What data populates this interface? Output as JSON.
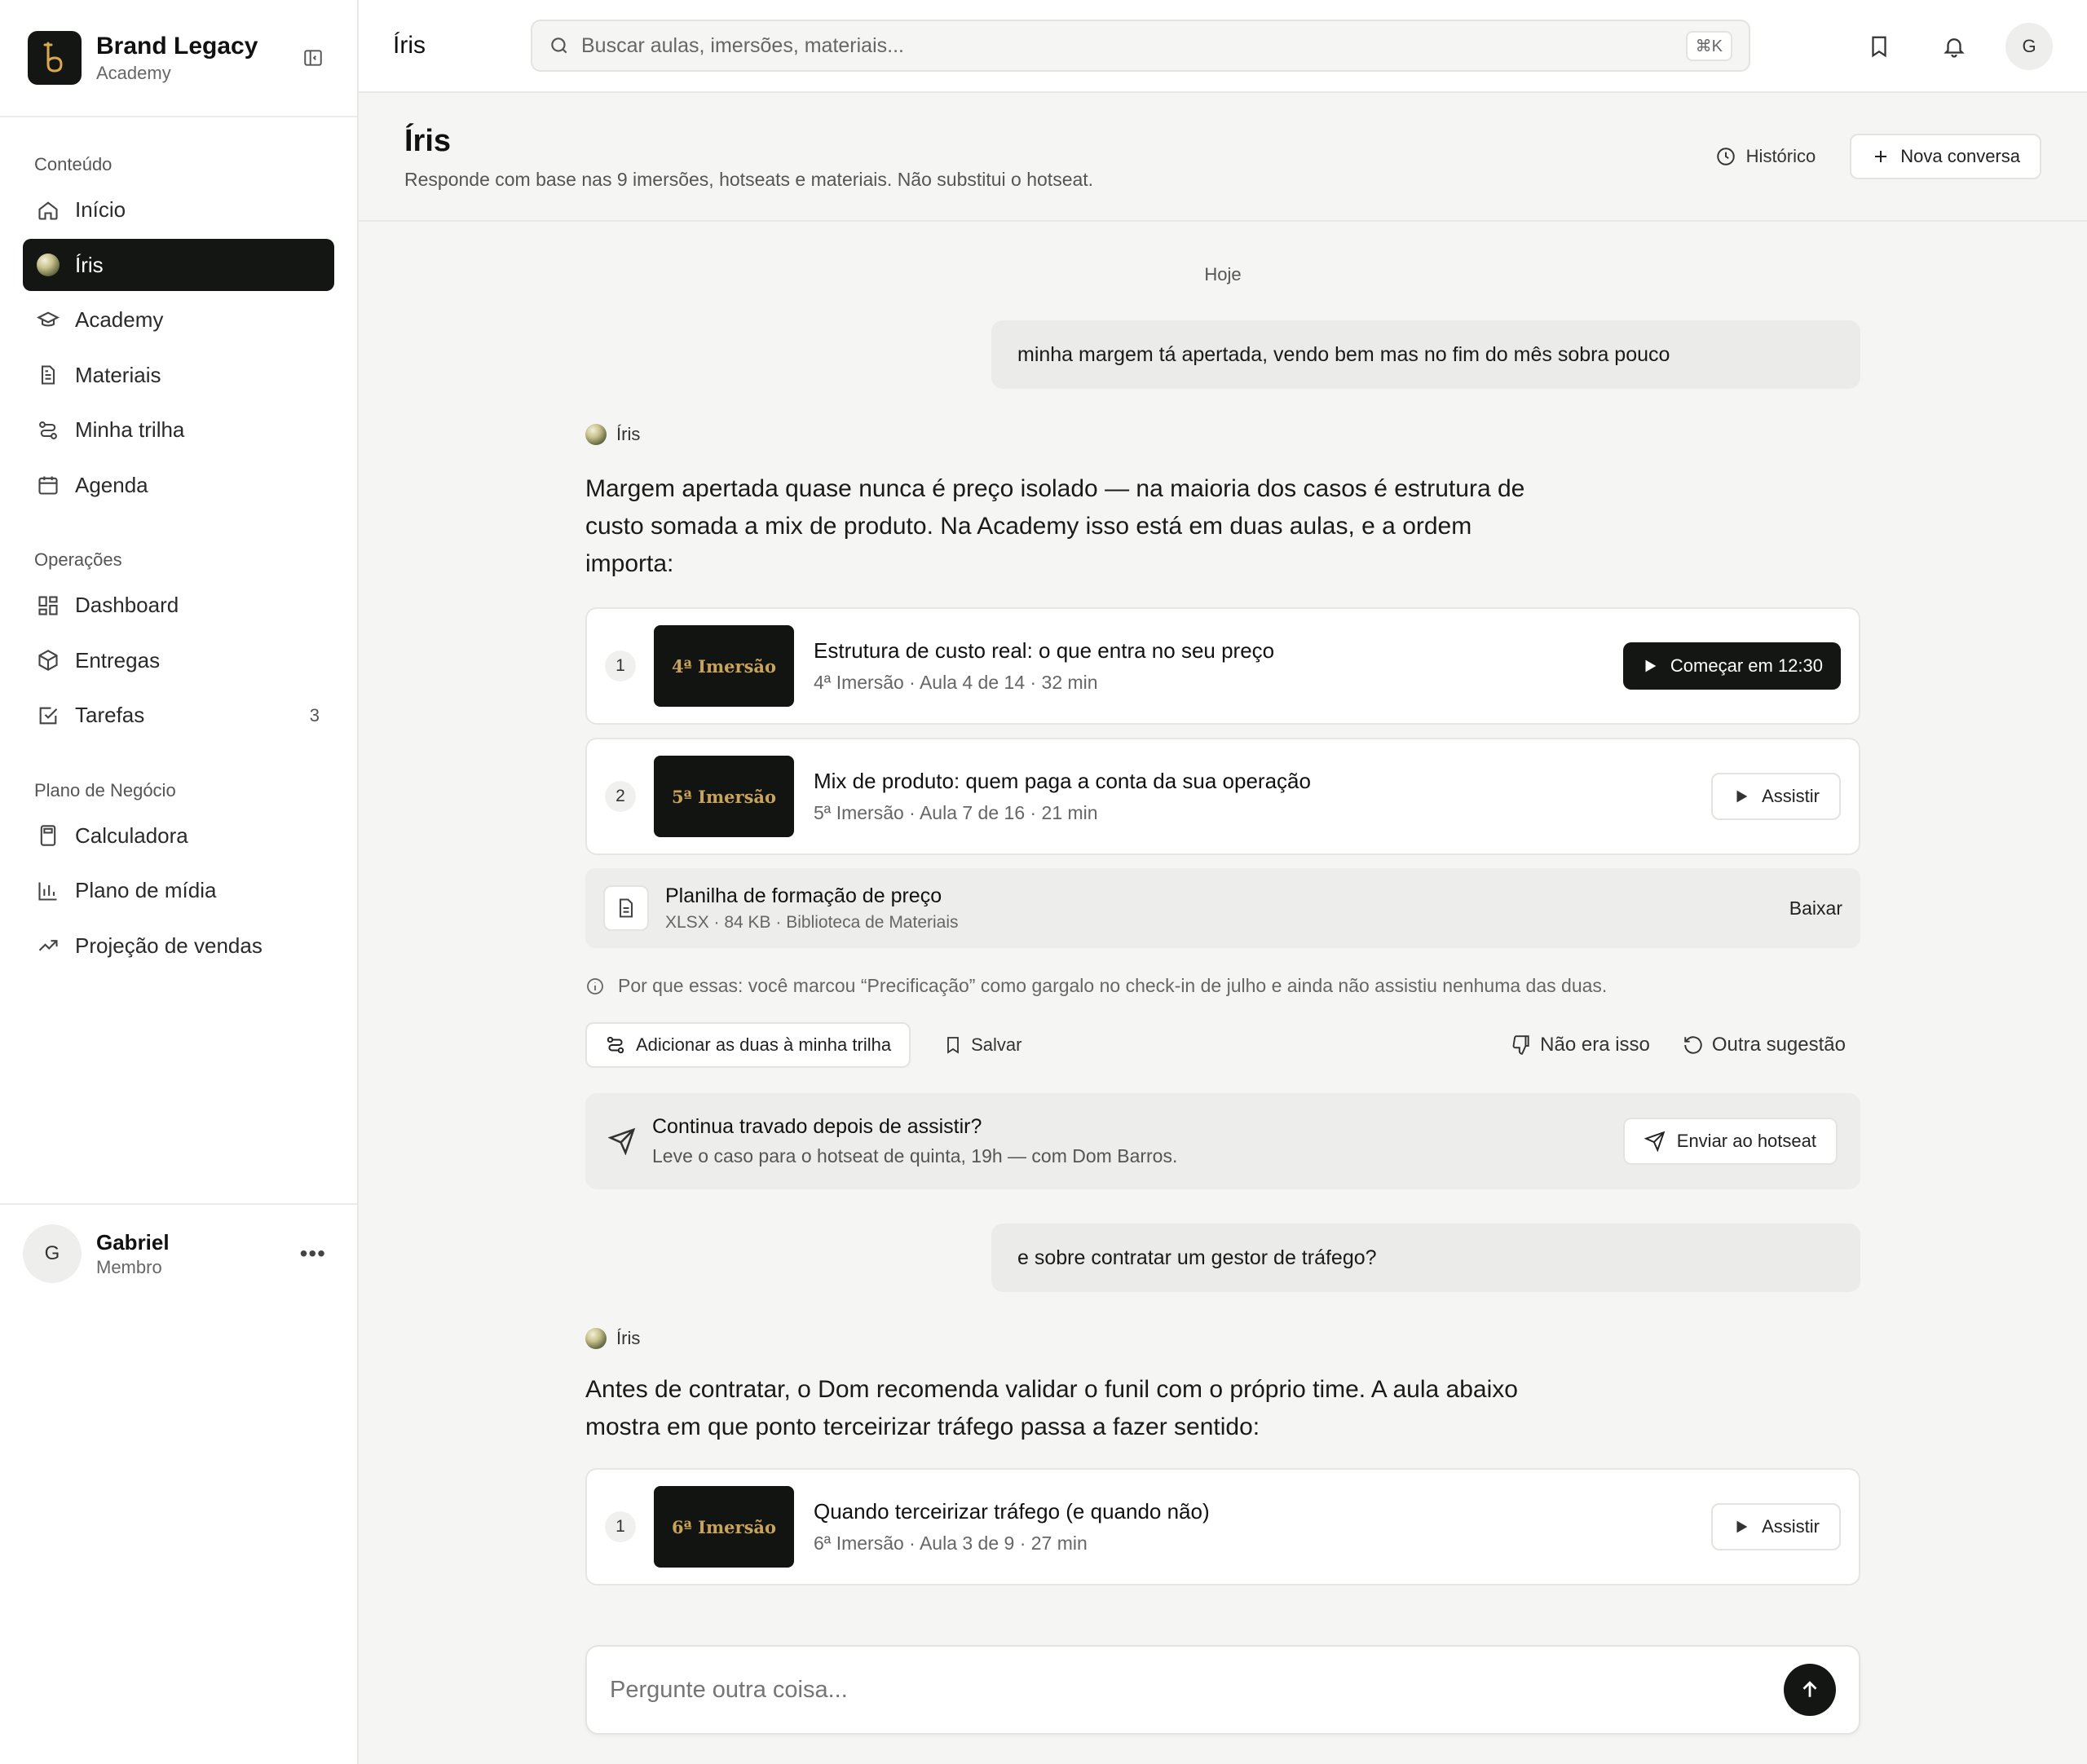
{
  "brand": {
    "title": "Brand Legacy",
    "subtitle": "Academy"
  },
  "sidebar": {
    "sections": [
      {
        "title": "Conteúdo",
        "items": [
          {
            "label": "Início",
            "icon": "home-icon"
          },
          {
            "label": "Íris",
            "icon": "iris-orb-icon",
            "active": true
          },
          {
            "label": "Academy",
            "icon": "graduation-cap-icon"
          },
          {
            "label": "Materiais",
            "icon": "document-icon"
          },
          {
            "label": "Minha trilha",
            "icon": "route-icon"
          },
          {
            "label": "Agenda",
            "icon": "calendar-icon"
          }
        ]
      },
      {
        "title": "Operações",
        "items": [
          {
            "label": "Dashboard",
            "icon": "dashboard-icon"
          },
          {
            "label": "Entregas",
            "icon": "package-icon"
          },
          {
            "label": "Tarefas",
            "icon": "checkbox-icon",
            "count": "3"
          }
        ]
      },
      {
        "title": "Plano de Negócio",
        "items": [
          {
            "label": "Calculadora",
            "icon": "calculator-icon"
          },
          {
            "label": "Plano de mídia",
            "icon": "bar-chart-icon"
          },
          {
            "label": "Projeção de vendas",
            "icon": "trending-up-icon"
          }
        ]
      }
    ],
    "user": {
      "initial": "G",
      "name": "Gabriel",
      "role": "Membro",
      "more": "•••"
    }
  },
  "topbar": {
    "title": "Íris",
    "search_placeholder": "Buscar aulas, imersões, materiais...",
    "shortcut": "⌘K",
    "avatar_initial": "G"
  },
  "page": {
    "title": "Íris",
    "subtitle": "Responde com base nas 9 imersões, hotseats e materiais. Não substitui o hotseat.",
    "history_label": "Histórico",
    "new_chat_label": "Nova conversa"
  },
  "chat": {
    "day_label": "Hoje",
    "user_msg_1": "minha margem tá apertada, vendo bem mas no fim do mês sobra pouco",
    "assistant_name": "Íris",
    "assistant_msg_1": "Margem apertada quase nunca é preço isolado — na maioria dos casos é estrutura de custo somada a mix de produto. Na Academy isso está em duas aulas, e a ordem importa:",
    "lessons_1": [
      {
        "num": "1",
        "thumb": "4ª Imersão",
        "title": "Estrutura de custo real: o que entra no seu preço",
        "meta": "4ª Imersão · Aula 4 de 14 · 32 min",
        "cta": "Começar em 12:30"
      },
      {
        "num": "2",
        "thumb": "5ª Imersão",
        "title": "Mix de produto: quem paga a conta da sua operação",
        "meta": "5ª Imersão · Aula 7 de 16 · 21 min",
        "cta": "Assistir"
      }
    ],
    "file": {
      "title": "Planilha de formação de preço",
      "meta": "XLSX · 84 KB · Biblioteca de Materiais",
      "action": "Baixar"
    },
    "why": "Por que essas: você marcou “Precificação” como gargalo no check-in de julho e ainda não assistiu nenhuma das duas.",
    "actions": {
      "add_trail": "Adicionar as duas à minha trilha",
      "save": "Salvar",
      "not_it": "Não era isso",
      "other": "Outra sugestão"
    },
    "hotseat": {
      "title": "Continua travado depois de assistir?",
      "subtitle": "Leve o caso para o hotseat de quinta, 19h — com Dom Barros.",
      "cta": "Enviar ao hotseat"
    },
    "user_msg_2": "e sobre contratar um gestor de tráfego?",
    "assistant_msg_2": "Antes de contratar, o Dom recomenda validar o funil com o próprio time. A aula abaixo mostra em que ponto terceirizar tráfego passa a fazer sentido:",
    "lessons_2": [
      {
        "num": "1",
        "thumb": "6ª Imersão",
        "title": "Quando terceirizar tráfego (e quando não)",
        "meta": "6ª Imersão · Aula 3 de 9 · 27 min",
        "cta": "Assistir"
      }
    ],
    "composer_placeholder": "Pergunte outra coisa..."
  },
  "colors": {
    "accent_dark": "#141613",
    "thumb_gold": "#c9a35a",
    "background": "#f5f5f4"
  }
}
